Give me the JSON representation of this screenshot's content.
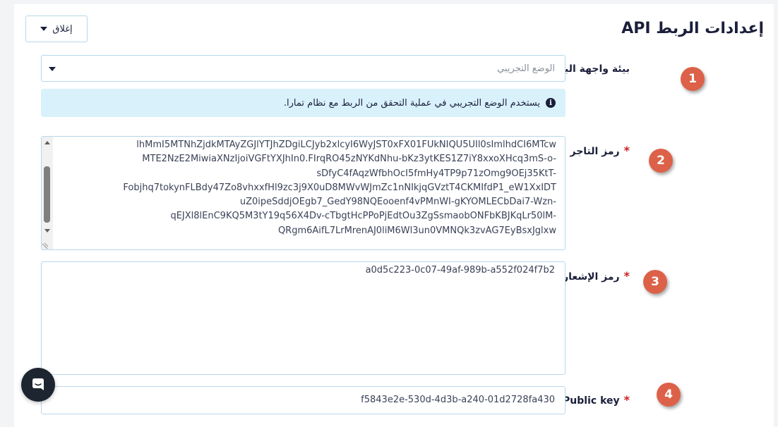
{
  "page": {
    "title": "إعدادات الربط API",
    "close_button_label": "إغلاق"
  },
  "api_environment": {
    "label": "بيئة واجهة البرمجة",
    "selected_value": "الوضع التجريبي",
    "info_message": "يستخدم الوضع التجريبي في عملية التحقق من الربط مع نظام تمارا."
  },
  "merchant_token": {
    "label": "رمز التاجر",
    "visible_lines": [
      "lhMmI5MTNhZjdkMTAyZGJlYTJhZDgiLCJyb2xlcyI6WyJST0xFX01FUkNIQU5UIl0sImlhdCI6MTcw",
      "MTE2NzE2MiwiaXNzIjoiVGFtYXJhIn0.FIrqRO45zNYKdNhu-bKz3ytKES1Z7iY8xxoXHcq3mS-o-",
      "sDfyC4fAqzWfbhOcI5fmHy4TP9p71zOmg9OEj35KtT-",
      "Fobjhq7tokynFLBdy47Zo8vhxxfHl9zc3j9X0uD8MWvWJmZc1nNIkjqGVztT4CKMIfdP1_eW1XxIDT",
      "uZ0ipeSddjOEgb7_GedY98NQEooenf4vPMnWI-gKYOMLECbDai7-Wzn-",
      "qEJXl8lEnC9KQ5M3tY19q56X4Dv-cTbgtHcPPoPjEdtOu3ZgSsmaobONFbKBJKqLr50lM-",
      "QRgm6AifL7LrMrenAJ0liM6Wl3un0VMNQk3zvAG7EyBsxJglxw"
    ]
  },
  "notification_token": {
    "label": "رمز الإشعار",
    "value": "a0d5c223-0c07-49af-989b-a552f024f7b2"
  },
  "public_key": {
    "label": "Public key",
    "value": "f5843e2e-530d-4d3b-a240-01d2728fa430"
  },
  "badges": [
    "1",
    "2",
    "3",
    "4"
  ],
  "colors": {
    "badge": "#dd6148",
    "required": "#cc1f1f",
    "info_bg": "#d9f1fb",
    "input_border": "#b9d7e9",
    "title": "#1b1f3b"
  },
  "icons": {
    "close_caret": "caret-down-icon",
    "select_caret": "caret-down-icon",
    "info": "info-circle-icon",
    "chat": "chat-bubble-icon"
  }
}
